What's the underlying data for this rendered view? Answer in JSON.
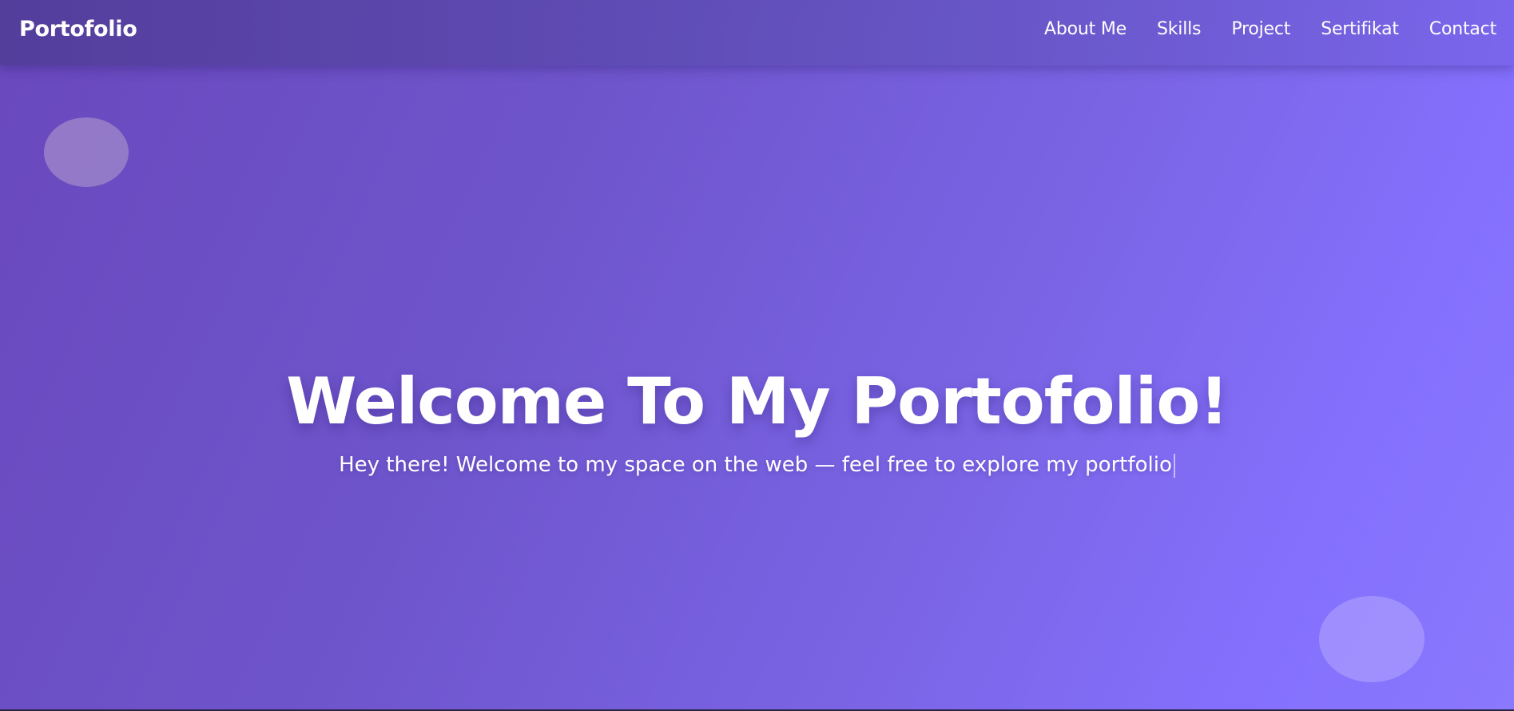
{
  "navbar": {
    "brand": "Portofolio",
    "links": [
      {
        "label": "About Me"
      },
      {
        "label": "Skills"
      },
      {
        "label": "Project"
      },
      {
        "label": "Sertifikat"
      },
      {
        "label": "Contact"
      }
    ]
  },
  "hero": {
    "title": "Welcome To My Portofolio!",
    "subtitle": "Hey there! Welcome to my space on the web — feel free to explore my portfolio"
  },
  "colors": {
    "gradient_start": "#6a48bd",
    "gradient_end": "#8a78fd",
    "text": "#ffffff"
  }
}
